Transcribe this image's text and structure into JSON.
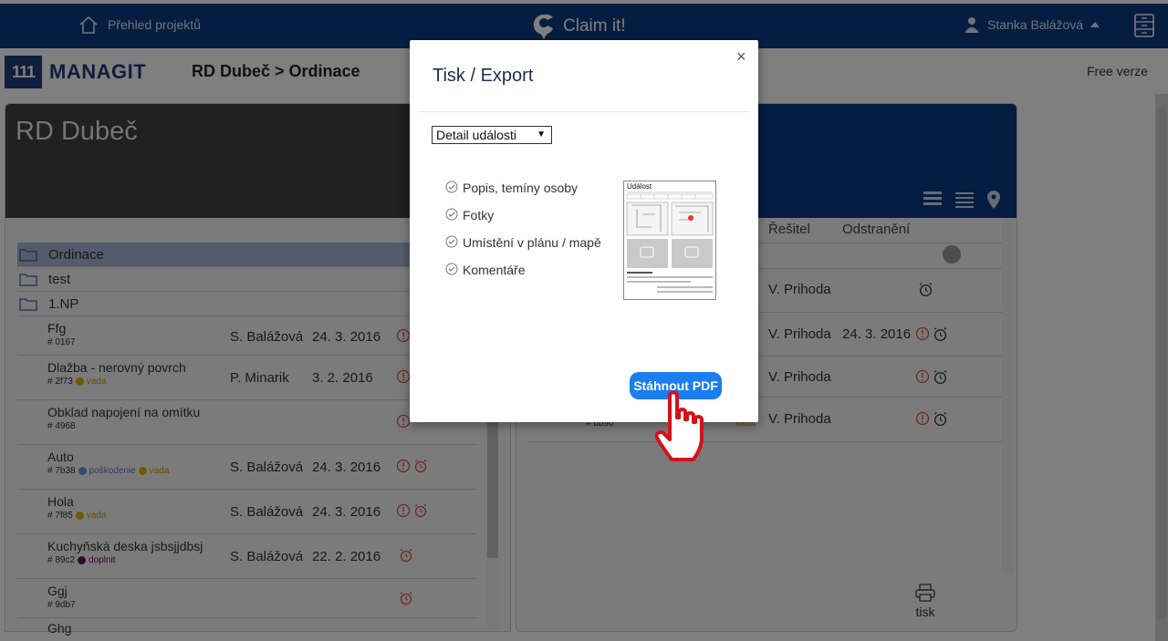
{
  "topbar": {
    "home_label": "Přehled projektů",
    "brand": "Claim it!",
    "user": "Stanka Balážová"
  },
  "subheader": {
    "logo_mark": "111",
    "logo_text": "MANAGIT",
    "breadcrumb": "RD Dubeč > Ordinace",
    "plan": "Free verze"
  },
  "left": {
    "title": "RD Dubeč",
    "folders": [
      "Ordinace",
      "test",
      "1.NP"
    ],
    "rows": [
      {
        "name": "Ffg",
        "id": "# 0167",
        "tags": [],
        "who": "S. Balážová",
        "date": "24. 3. 2016"
      },
      {
        "name": "Dlažba - nerovný povrch",
        "id": "# 2f73",
        "tags": [
          {
            "label": "vada",
            "color": "#e0b400"
          }
        ],
        "who": "P. Minarik",
        "date": "3. 2. 2016"
      },
      {
        "name": "Obklad napojení na omítku",
        "id": "# 4968",
        "tags": [],
        "who": "",
        "date": ""
      },
      {
        "name": "Auto",
        "id": "# 7b38",
        "tags": [
          {
            "label": "poškodenie",
            "color": "#7b8ce0"
          },
          {
            "label": "vada",
            "color": "#e0b400"
          }
        ],
        "who": "S. Balážová",
        "date": "24. 3. 2016"
      },
      {
        "name": "Hola",
        "id": "# 7f85",
        "tags": [
          {
            "label": "vada",
            "color": "#e0b400"
          }
        ],
        "who": "S. Balážová",
        "date": "24. 3. 2016"
      },
      {
        "name": "Kuchyňská deska jsbsjjdbsj",
        "id": "# 89c2",
        "tags": [
          {
            "label": "doplnit",
            "color": "#6b1060"
          }
        ],
        "who": "S. Balážová",
        "date": "22. 2. 2016"
      },
      {
        "name": "Ggj",
        "id": "# 9db7",
        "tags": [],
        "who": "",
        "date": ""
      },
      {
        "name": "Ghg",
        "id": "",
        "tags": [],
        "who": "",
        "date": ""
      }
    ]
  },
  "right": {
    "col_resitel": "Řešitel",
    "col_odstraneni": "Odstranění",
    "rows": [
      {
        "resitel": "V. Prihoda",
        "date": ""
      },
      {
        "resitel": "V. Prihoda",
        "date": "24. 3. 2016"
      },
      {
        "resitel": "V. Prihoda",
        "date": ""
      },
      {
        "resitel": "V. Prihoda",
        "date": ""
      }
    ],
    "partial_id": "# db90",
    "partial_tag": "vada",
    "print_label": "tisk"
  },
  "modal": {
    "title": "Tisk / Export",
    "close": "×",
    "select_value": "Detail události",
    "options": [
      "Popis, temíny osoby",
      "Fotky",
      "Umístění v plánu / mapě",
      "Komentáře"
    ],
    "preview_title": "Událost",
    "download": "Stáhnout PDF"
  },
  "colors": {
    "brand_blue": "#0a3a82",
    "button_blue": "#1a7df0",
    "alert_red": "#d9534f"
  }
}
